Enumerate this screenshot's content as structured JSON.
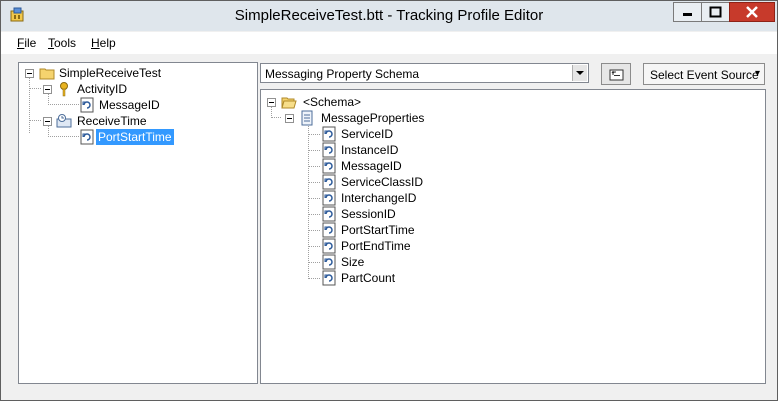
{
  "window": {
    "title": "SimpleReceiveTest.btt - Tracking Profile Editor"
  },
  "menu": {
    "file": "File",
    "tools": "Tools",
    "help": "Help"
  },
  "left_tree": {
    "root": "SimpleReceiveTest",
    "activity": "ActivityID",
    "activity_child": "MessageID",
    "receive": "ReceiveTime",
    "receive_child": "PortStartTime"
  },
  "schema_combo": {
    "value": "Messaging Property Schema"
  },
  "select_event_source": {
    "label": "Select Event Source"
  },
  "right_tree": {
    "root": "<Schema>",
    "group": "MessageProperties",
    "items": [
      "ServiceID",
      "InstanceID",
      "MessageID",
      "ServiceClassID",
      "InterchangeID",
      "SessionID",
      "PortStartTime",
      "PortEndTime",
      "Size",
      "PartCount"
    ]
  },
  "colors": {
    "selection": "#3399ff",
    "close_button": "#c73a2b"
  }
}
